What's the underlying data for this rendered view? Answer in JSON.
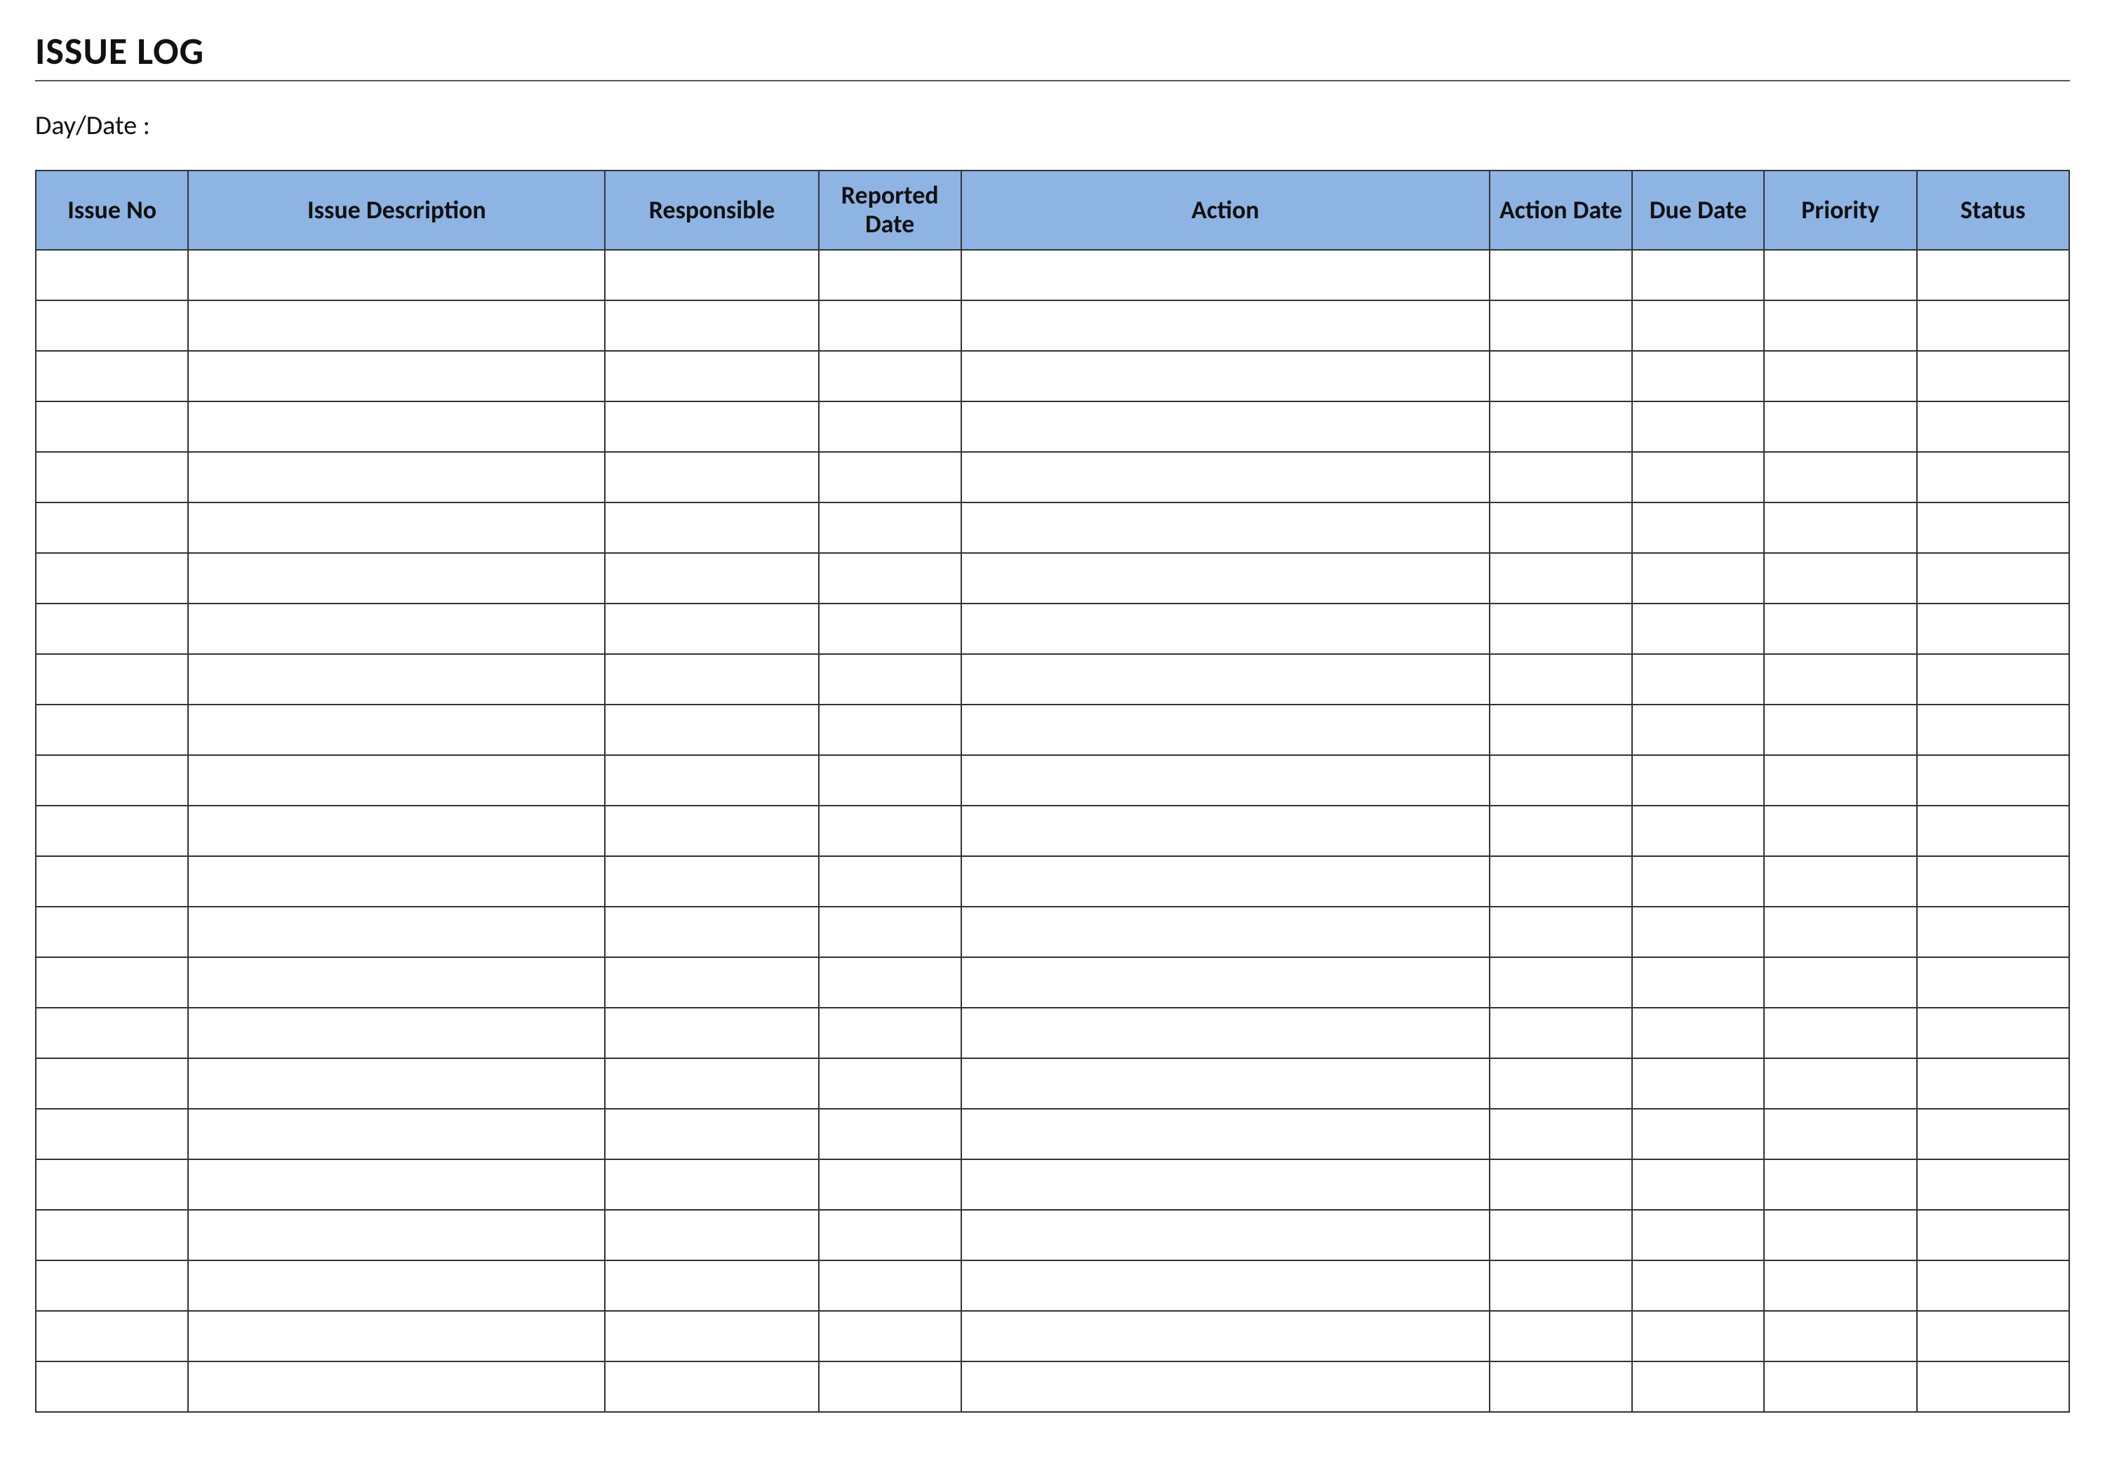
{
  "title": "ISSUE LOG",
  "meta": {
    "day_date_label": "Day/Date :",
    "day_date_value": ""
  },
  "columns": {
    "issue_no": "Issue No",
    "description": "Issue Description",
    "responsible": "Responsible",
    "reported_date": "Reported Date",
    "action": "Action",
    "action_date": "Action Date",
    "due_date": "Due Date",
    "priority": "Priority",
    "status": "Status"
  },
  "rows": [
    {
      "issue_no": "",
      "description": "",
      "responsible": "",
      "reported_date": "",
      "action": "",
      "action_date": "",
      "due_date": "",
      "priority": "",
      "status": ""
    },
    {
      "issue_no": "",
      "description": "",
      "responsible": "",
      "reported_date": "",
      "action": "",
      "action_date": "",
      "due_date": "",
      "priority": "",
      "status": ""
    },
    {
      "issue_no": "",
      "description": "",
      "responsible": "",
      "reported_date": "",
      "action": "",
      "action_date": "",
      "due_date": "",
      "priority": "",
      "status": ""
    },
    {
      "issue_no": "",
      "description": "",
      "responsible": "",
      "reported_date": "",
      "action": "",
      "action_date": "",
      "due_date": "",
      "priority": "",
      "status": ""
    },
    {
      "issue_no": "",
      "description": "",
      "responsible": "",
      "reported_date": "",
      "action": "",
      "action_date": "",
      "due_date": "",
      "priority": "",
      "status": ""
    },
    {
      "issue_no": "",
      "description": "",
      "responsible": "",
      "reported_date": "",
      "action": "",
      "action_date": "",
      "due_date": "",
      "priority": "",
      "status": ""
    },
    {
      "issue_no": "",
      "description": "",
      "responsible": "",
      "reported_date": "",
      "action": "",
      "action_date": "",
      "due_date": "",
      "priority": "",
      "status": ""
    },
    {
      "issue_no": "",
      "description": "",
      "responsible": "",
      "reported_date": "",
      "action": "",
      "action_date": "",
      "due_date": "",
      "priority": "",
      "status": ""
    },
    {
      "issue_no": "",
      "description": "",
      "responsible": "",
      "reported_date": "",
      "action": "",
      "action_date": "",
      "due_date": "",
      "priority": "",
      "status": ""
    },
    {
      "issue_no": "",
      "description": "",
      "responsible": "",
      "reported_date": "",
      "action": "",
      "action_date": "",
      "due_date": "",
      "priority": "",
      "status": ""
    },
    {
      "issue_no": "",
      "description": "",
      "responsible": "",
      "reported_date": "",
      "action": "",
      "action_date": "",
      "due_date": "",
      "priority": "",
      "status": ""
    },
    {
      "issue_no": "",
      "description": "",
      "responsible": "",
      "reported_date": "",
      "action": "",
      "action_date": "",
      "due_date": "",
      "priority": "",
      "status": ""
    },
    {
      "issue_no": "",
      "description": "",
      "responsible": "",
      "reported_date": "",
      "action": "",
      "action_date": "",
      "due_date": "",
      "priority": "",
      "status": ""
    },
    {
      "issue_no": "",
      "description": "",
      "responsible": "",
      "reported_date": "",
      "action": "",
      "action_date": "",
      "due_date": "",
      "priority": "",
      "status": ""
    },
    {
      "issue_no": "",
      "description": "",
      "responsible": "",
      "reported_date": "",
      "action": "",
      "action_date": "",
      "due_date": "",
      "priority": "",
      "status": ""
    },
    {
      "issue_no": "",
      "description": "",
      "responsible": "",
      "reported_date": "",
      "action": "",
      "action_date": "",
      "due_date": "",
      "priority": "",
      "status": ""
    },
    {
      "issue_no": "",
      "description": "",
      "responsible": "",
      "reported_date": "",
      "action": "",
      "action_date": "",
      "due_date": "",
      "priority": "",
      "status": ""
    },
    {
      "issue_no": "",
      "description": "",
      "responsible": "",
      "reported_date": "",
      "action": "",
      "action_date": "",
      "due_date": "",
      "priority": "",
      "status": ""
    },
    {
      "issue_no": "",
      "description": "",
      "responsible": "",
      "reported_date": "",
      "action": "",
      "action_date": "",
      "due_date": "",
      "priority": "",
      "status": ""
    },
    {
      "issue_no": "",
      "description": "",
      "responsible": "",
      "reported_date": "",
      "action": "",
      "action_date": "",
      "due_date": "",
      "priority": "",
      "status": ""
    },
    {
      "issue_no": "",
      "description": "",
      "responsible": "",
      "reported_date": "",
      "action": "",
      "action_date": "",
      "due_date": "",
      "priority": "",
      "status": ""
    },
    {
      "issue_no": "",
      "description": "",
      "responsible": "",
      "reported_date": "",
      "action": "",
      "action_date": "",
      "due_date": "",
      "priority": "",
      "status": ""
    },
    {
      "issue_no": "",
      "description": "",
      "responsible": "",
      "reported_date": "",
      "action": "",
      "action_date": "",
      "due_date": "",
      "priority": "",
      "status": ""
    }
  ]
}
